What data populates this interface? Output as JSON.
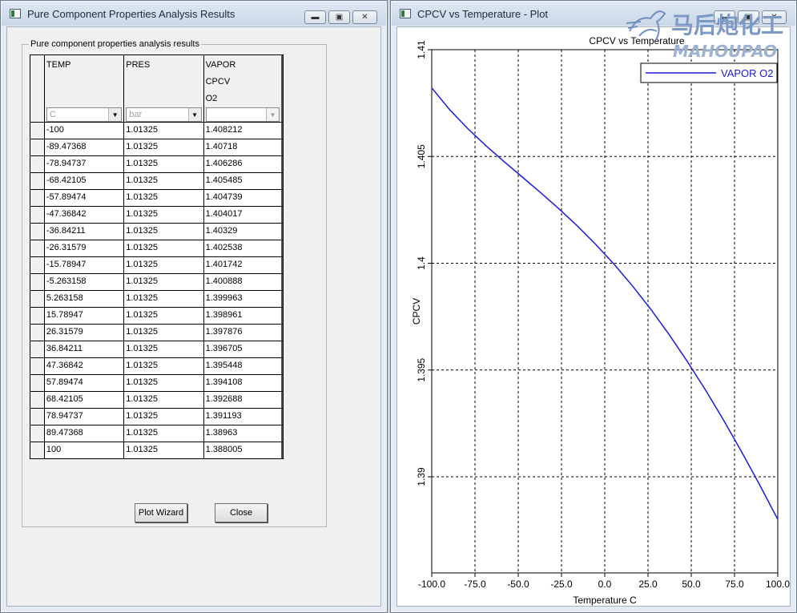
{
  "left_window": {
    "title": "Pure Component Properties Analysis Results",
    "group_label": "Pure component properties analysis results",
    "columns": [
      {
        "lines": [
          "TEMP"
        ],
        "unit": "C",
        "unit_enabled": true
      },
      {
        "lines": [
          "PRES"
        ],
        "unit": "bar",
        "unit_enabled": true
      },
      {
        "lines": [
          "VAPOR",
          "CPCV",
          "O2"
        ],
        "unit": "",
        "unit_enabled": false
      }
    ],
    "rows": [
      [
        "-100",
        "1.01325",
        "1.408212"
      ],
      [
        "-89.47368",
        "1.01325",
        "1.40718"
      ],
      [
        "-78.94737",
        "1.01325",
        "1.406286"
      ],
      [
        "-68.42105",
        "1.01325",
        "1.405485"
      ],
      [
        "-57.89474",
        "1.01325",
        "1.404739"
      ],
      [
        "-47.36842",
        "1.01325",
        "1.404017"
      ],
      [
        "-36.84211",
        "1.01325",
        "1.40329"
      ],
      [
        "-26.31579",
        "1.01325",
        "1.402538"
      ],
      [
        "-15.78947",
        "1.01325",
        "1.401742"
      ],
      [
        "-5.263158",
        "1.01325",
        "1.400888"
      ],
      [
        "5.263158",
        "1.01325",
        "1.399963"
      ],
      [
        "15.78947",
        "1.01325",
        "1.398961"
      ],
      [
        "26.31579",
        "1.01325",
        "1.397876"
      ],
      [
        "36.84211",
        "1.01325",
        "1.396705"
      ],
      [
        "47.36842",
        "1.01325",
        "1.395448"
      ],
      [
        "57.89474",
        "1.01325",
        "1.394108"
      ],
      [
        "68.42105",
        "1.01325",
        "1.392688"
      ],
      [
        "78.94737",
        "1.01325",
        "1.391193"
      ],
      [
        "89.47368",
        "1.01325",
        "1.38963"
      ],
      [
        "100",
        "1.01325",
        "1.388005"
      ]
    ],
    "buttons": {
      "plot_wizard": "Plot Wizard",
      "close": "Close"
    }
  },
  "right_window": {
    "title": "CPCV vs Temperature - Plot"
  },
  "watermark": {
    "line1": "马后炮化工",
    "line2": "MAHOUPAO"
  },
  "colors": {
    "series": "#1a1adc",
    "grid": "#000000"
  },
  "chart_data": {
    "type": "line",
    "title": "CPCV vs Temperature",
    "xlabel": "Temperature  C",
    "ylabel": "CPCV",
    "xlim": [
      -100,
      100
    ],
    "ylim": [
      1.3855,
      1.41
    ],
    "x_ticks": [
      -100,
      -75,
      -50,
      -25,
      0,
      25,
      50,
      75,
      100
    ],
    "x_tick_labels": [
      "-100.0",
      "-75.0",
      "-50.0",
      "-25.0",
      "0.0",
      "25.0",
      "50.0",
      "75.0",
      "100.0"
    ],
    "y_ticks": [
      1.39,
      1.395,
      1.4,
      1.405,
      1.41
    ],
    "y_tick_labels": [
      "1.39",
      "1.395",
      "1.4",
      "1.405",
      "1.41"
    ],
    "grid": true,
    "legend_position": "top-right",
    "series": [
      {
        "name": "VAPOR O2",
        "x": [
          -100,
          -89.47368,
          -78.94737,
          -68.42105,
          -57.89474,
          -47.36842,
          -36.84211,
          -26.31579,
          -15.78947,
          -5.263158,
          5.263158,
          15.78947,
          26.31579,
          36.84211,
          47.36842,
          57.89474,
          68.42105,
          78.94737,
          89.47368,
          100
        ],
        "y": [
          1.408212,
          1.40718,
          1.406286,
          1.405485,
          1.404739,
          1.404017,
          1.40329,
          1.402538,
          1.401742,
          1.400888,
          1.399963,
          1.398961,
          1.397876,
          1.396705,
          1.395448,
          1.394108,
          1.392688,
          1.391193,
          1.38963,
          1.388005
        ]
      }
    ]
  }
}
